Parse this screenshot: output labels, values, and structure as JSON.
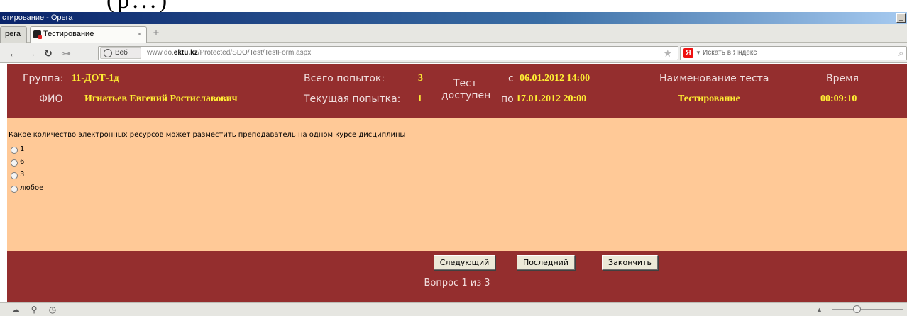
{
  "window": {
    "title": "стирование - Opera",
    "minimize_label": "_"
  },
  "tabs": [
    {
      "label": "pera"
    },
    {
      "label": "Тестирование",
      "close": "×"
    }
  ],
  "newtab_label": "+",
  "nav": {
    "back": "←",
    "forward": "→",
    "reload": "↻",
    "key": "⊶"
  },
  "address": {
    "badge": "Веб",
    "url_prefix": "www.do.",
    "url_host": "ektu.kz",
    "url_path": "/Protected/SDO/Test/TestForm.aspx",
    "star": "★"
  },
  "search": {
    "logo": "Я",
    "caret": "▼",
    "placeholder": "Искать в Яндекс",
    "mag": "⌕"
  },
  "header": {
    "group_label": "Группа:",
    "group_value": "11-ДОТ-1д",
    "fio_label": "ФИО",
    "fio_value": "Игнатьев Евгений Ростиславович",
    "attempts_total_label": "Всего попыток:",
    "attempts_total_value": "3",
    "attempt_current_label": "Текущая попытка:",
    "attempt_current_value": "1",
    "available_line1": "Тест",
    "available_line2": "доступен",
    "from_label": "с",
    "from_value": "06.01.2012 14:00",
    "to_label": "по",
    "to_value": "17.01.2012 20:00",
    "test_name_label": "Наименование теста",
    "test_name_value": "Тестирование",
    "time_label": "Время",
    "time_value": "00:09:10"
  },
  "question": {
    "text": "Какое количество электронных ресурсов может разместить преподаватель на одном курсе дисциплины",
    "options": [
      "1",
      "6",
      "3",
      "любое"
    ]
  },
  "footer": {
    "next_button": "Следующий",
    "last_button": "Последний",
    "finish_button": "Закончить",
    "counter_prefix": "Вопрос",
    "counter_current": "1",
    "counter_mid": "из",
    "counter_total": "3"
  },
  "statusbar": {
    "zoom_up": "▲"
  }
}
